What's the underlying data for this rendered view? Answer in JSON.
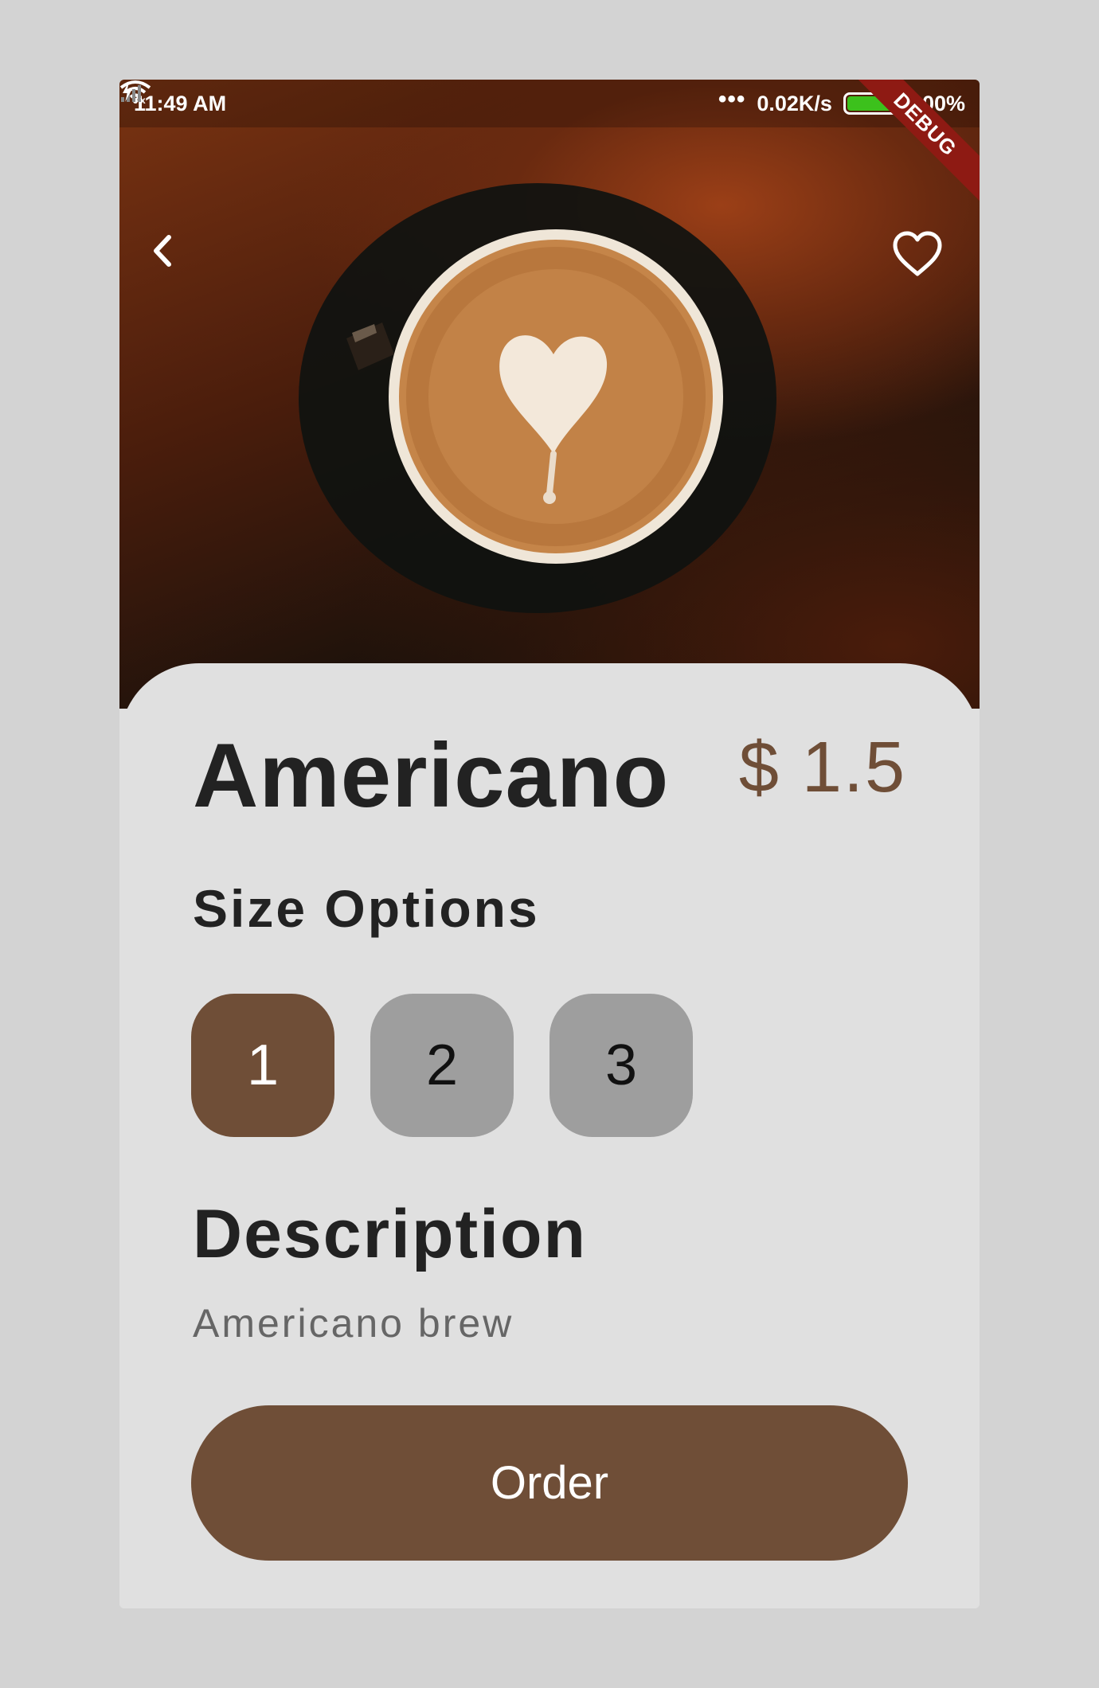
{
  "status_bar": {
    "time": "11:49 AM",
    "network_speed": "0.02K/s",
    "battery": "100%",
    "battery_level": 1.0,
    "debug_banner": "DEBUG"
  },
  "hero": {
    "image": "latte-art-coffee-cup",
    "back_icon": "chevron-left-icon",
    "favorite_icon": "heart-outline-icon"
  },
  "product": {
    "name": "Americano",
    "price": "$ 1.5"
  },
  "size_options": {
    "heading": "Size Options",
    "options": [
      "1",
      "2",
      "3"
    ],
    "selected": "1"
  },
  "description": {
    "heading": "Description",
    "text": "Americano brew"
  },
  "order_button": {
    "label": "Order"
  },
  "colors": {
    "accent": "#6f4e37",
    "unselected": "#9e9e9e",
    "card_bg": "#e0e0e0",
    "debug_banner": "#8e1a13",
    "battery_fill": "#3cc11c"
  }
}
